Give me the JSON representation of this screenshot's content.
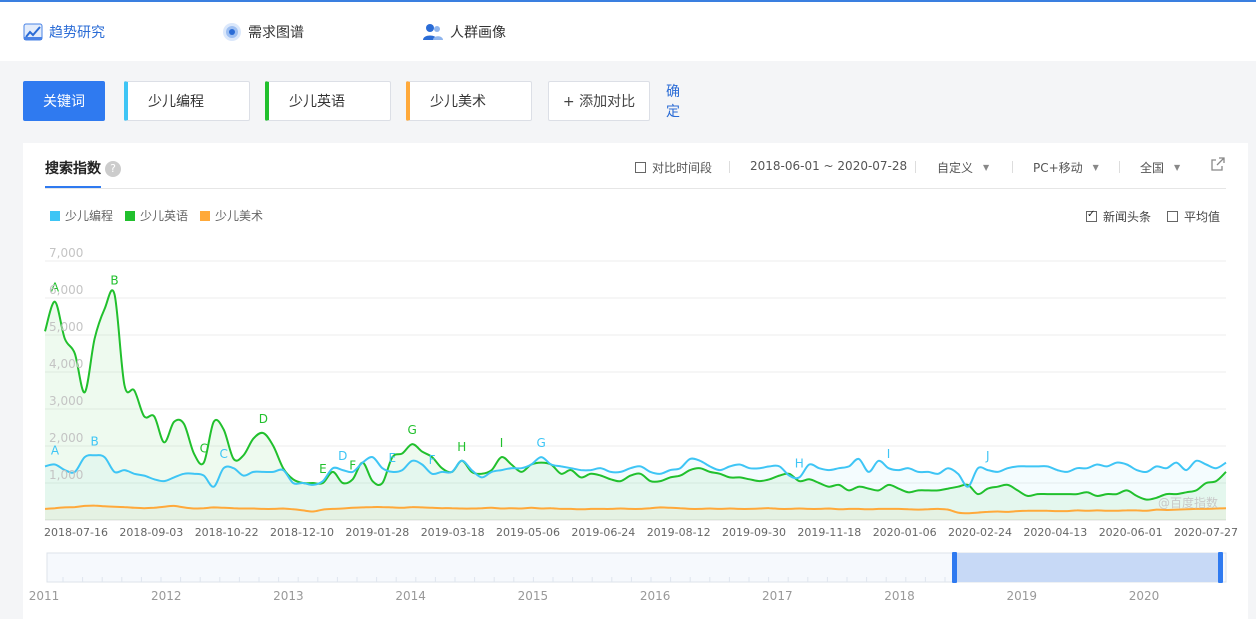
{
  "nav": {
    "items": [
      {
        "label": "趋势研究",
        "icon": "trend-chart-icon",
        "active": true
      },
      {
        "label": "需求图谱",
        "icon": "target-icon",
        "active": false
      },
      {
        "label": "人群画像",
        "icon": "people-icon",
        "active": false
      }
    ]
  },
  "keywords": {
    "main_label": "关键词",
    "items": [
      {
        "label": "少儿编程",
        "color": "#3ec5f5"
      },
      {
        "label": "少儿英语",
        "color": "#21c02d"
      },
      {
        "label": "少儿美术",
        "color": "#ffa93a"
      }
    ],
    "add_label": "+ 添加对比",
    "confirm_label": "确定"
  },
  "panel": {
    "tab_label": "搜索指数",
    "help_glyph": "?",
    "compare_period_label": "对比时间段",
    "date_range": "2018-06-01 ~ 2020-07-28",
    "range_mode": "自定义",
    "device": "PC+移动",
    "region": "全国",
    "news_label": "新闻头条",
    "news_checked": true,
    "average_label": "平均值",
    "average_checked": false,
    "watermark": "@百度指数"
  },
  "chart_data": {
    "type": "area",
    "ylim": [
      0,
      7000
    ],
    "yticks": [
      "7,000",
      "6,000",
      "5,000",
      "4,000",
      "3,000",
      "2,000",
      "1,000"
    ],
    "x_start": "2018-06-01",
    "x_end": "2020-07-28",
    "xtick_labels": [
      "2018-07-16",
      "2018-09-03",
      "2018-10-22",
      "2018-12-10",
      "2019-01-28",
      "2019-03-18",
      "2019-05-06",
      "2019-06-24",
      "2019-08-12",
      "2019-09-30",
      "2019-11-18",
      "2020-01-06",
      "2020-02-24",
      "2020-04-13",
      "2020-06-01",
      "2020-07-27"
    ],
    "series": [
      {
        "name": "少儿编程",
        "color": "#3ec5f5",
        "values": [
          1450,
          1500,
          1350,
          1300,
          1700,
          1750,
          1700,
          1300,
          1350,
          1250,
          1200,
          1100,
          1050,
          1150,
          1250,
          1250,
          1200,
          900,
          1400,
          1400,
          1200,
          1300,
          1300,
          1300,
          1350,
          1000,
          1000,
          950,
          1050,
          1400,
          1350,
          1300,
          1550,
          1700,
          1400,
          1300,
          1350,
          1600,
          1500,
          1250,
          1300,
          1300,
          1600,
          1350,
          1150,
          1300,
          1350,
          1400,
          1400,
          1500,
          1700,
          1500,
          1450,
          1400,
          1350,
          1350,
          1400,
          1300,
          1300,
          1400,
          1450,
          1300,
          1250,
          1350,
          1400,
          1650,
          1600,
          1450,
          1350,
          1450,
          1500,
          1400,
          1400,
          1450,
          1450,
          1200,
          1150,
          1500,
          1400,
          1350,
          1400,
          1450,
          1650,
          1300,
          1600,
          1400,
          1350,
          1400,
          1300,
          1300,
          1250,
          1400,
          1250,
          900,
          1400,
          1350,
          1300,
          1400,
          1450,
          1450,
          1450,
          1450,
          1350,
          1300,
          1400,
          1400,
          1500,
          1450,
          1550,
          1500,
          1350,
          1300,
          1450,
          1400,
          1550,
          1350,
          1600,
          1500,
          1400,
          1550
        ]
      },
      {
        "name": "少儿英语",
        "color": "#21c02d",
        "values": [
          5100,
          5900,
          4900,
          4500,
          3450,
          4900,
          5700,
          6100,
          3650,
          3500,
          2800,
          2800,
          2100,
          2650,
          2600,
          1800,
          1550,
          2650,
          2450,
          1650,
          1750,
          2200,
          2350,
          2000,
          1400,
          1100,
          1000,
          1000,
          1000,
          1300,
          1000,
          1100,
          1550,
          1050,
          1000,
          1700,
          1800,
          2050,
          1850,
          1700,
          1400,
          1300,
          1600,
          1300,
          1250,
          1350,
          1700,
          1500,
          1300,
          1500,
          1550,
          1500,
          1250,
          1350,
          1150,
          1250,
          1200,
          1100,
          1050,
          1200,
          1250,
          1050,
          1050,
          1150,
          1200,
          1350,
          1400,
          1300,
          1250,
          1150,
          1150,
          1100,
          1050,
          1100,
          1200,
          1250,
          1050,
          1100,
          1000,
          900,
          950,
          800,
          900,
          850,
          800,
          950,
          850,
          750,
          800,
          800,
          800,
          850,
          900,
          950,
          700,
          850,
          900,
          950,
          800,
          650,
          700,
          700,
          700,
          700,
          700,
          750,
          650,
          700,
          700,
          800,
          650,
          550,
          600,
          700,
          700,
          750,
          800,
          1000,
          1050,
          1300
        ]
      },
      {
        "name": "少儿美术",
        "color": "#ffa93a",
        "values": [
          300,
          320,
          340,
          350,
          380,
          390,
          370,
          360,
          350,
          330,
          320,
          330,
          360,
          380,
          340,
          310,
          320,
          340,
          330,
          320,
          310,
          310,
          300,
          300,
          310,
          290,
          260,
          230,
          280,
          300,
          310,
          330,
          340,
          350,
          350,
          340,
          330,
          350,
          340,
          330,
          320,
          320,
          310,
          310,
          320,
          330,
          310,
          320,
          310,
          330,
          310,
          320,
          300,
          300,
          290,
          300,
          300,
          300,
          310,
          300,
          300,
          320,
          340,
          330,
          320,
          300,
          300,
          310,
          300,
          310,
          300,
          300,
          310,
          320,
          300,
          300,
          310,
          300,
          300,
          310,
          290,
          300,
          300,
          290,
          300,
          300,
          300,
          290,
          280,
          290,
          300,
          280,
          200,
          180,
          200,
          220,
          230,
          220,
          240,
          250,
          250,
          250,
          240,
          240,
          260,
          250,
          260,
          250,
          250,
          260,
          260,
          250,
          280,
          270,
          280,
          290,
          300,
          300,
          310,
          320
        ]
      }
    ],
    "annotations": [
      {
        "series": "少儿英语",
        "label": "A",
        "index": 1
      },
      {
        "series": "少儿英语",
        "label": "B",
        "index": 7
      },
      {
        "series": "少儿英语",
        "label": "C",
        "index": 16
      },
      {
        "series": "少儿英语",
        "label": "D",
        "index": 22
      },
      {
        "series": "少儿英语",
        "label": "E",
        "index": 28
      },
      {
        "series": "少儿英语",
        "label": "F",
        "index": 31
      },
      {
        "series": "少儿英语",
        "label": "G",
        "index": 37
      },
      {
        "series": "少儿英语",
        "label": "H",
        "index": 42
      },
      {
        "series": "少儿英语",
        "label": "I",
        "index": 46
      },
      {
        "series": "少儿编程",
        "label": "A",
        "index": 1
      },
      {
        "series": "少儿编程",
        "label": "B",
        "index": 5
      },
      {
        "series": "少儿编程",
        "label": "C",
        "index": 18
      },
      {
        "series": "少儿编程",
        "label": "D",
        "index": 30
      },
      {
        "series": "少儿编程",
        "label": "E",
        "index": 35
      },
      {
        "series": "少儿编程",
        "label": "F",
        "index": 39
      },
      {
        "series": "少儿编程",
        "label": "G",
        "index": 50
      },
      {
        "series": "少儿编程",
        "label": "H",
        "index": 76
      },
      {
        "series": "少儿编程",
        "label": "I",
        "index": 85
      },
      {
        "series": "少儿编程",
        "label": "J",
        "index": 95
      }
    ],
    "grid": true,
    "legend_position": "top-left",
    "overview_year_labels": [
      "2011",
      "2012",
      "2013",
      "2014",
      "2015",
      "2016",
      "2017",
      "2018",
      "2019",
      "2020"
    ]
  }
}
